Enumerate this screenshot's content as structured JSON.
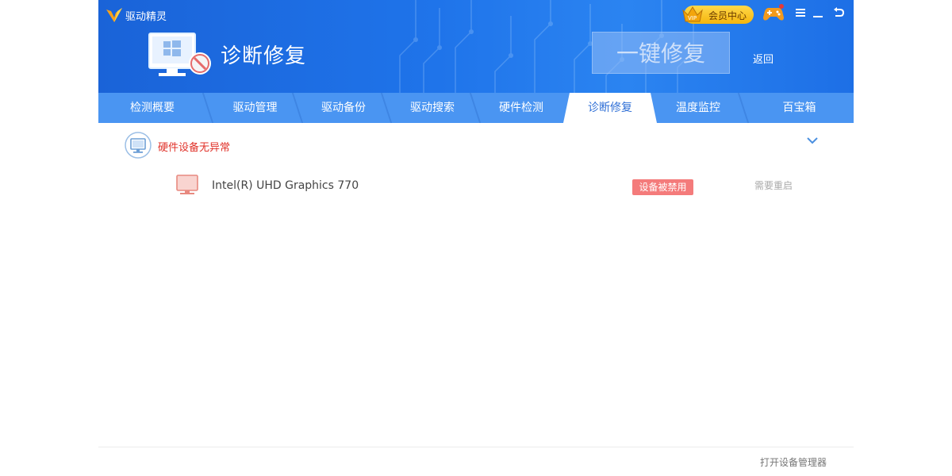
{
  "app": {
    "name": "驱动精灵"
  },
  "header": {
    "vip_label": "会员中心",
    "vip_badge": "VIP",
    "title": "诊断修复",
    "repair_button": "一键修复",
    "back_link": "返回"
  },
  "tabs": [
    {
      "label": "检测概要"
    },
    {
      "label": "驱动管理"
    },
    {
      "label": "驱动备份"
    },
    {
      "label": "驱动搜索"
    },
    {
      "label": "硬件检测"
    },
    {
      "label": "诊断修复",
      "active": true
    },
    {
      "label": "温度监控"
    },
    {
      "label": "百宝箱"
    }
  ],
  "section": {
    "title": "硬件设备无异常",
    "icon": "monitor-icon"
  },
  "device": {
    "name": "Intel(R) UHD Graphics 770",
    "status": "设备被禁用",
    "action": "需要重启",
    "icon": "display-icon"
  },
  "footer": {
    "open_device_manager": "打开设备管理器"
  },
  "colors": {
    "header_blue": "#1f74ea",
    "tab_bar": "#4a95f2",
    "active_tab_text": "#2f6fd6",
    "alert_red": "#e0322a",
    "status_badge": "#f47b7b"
  }
}
